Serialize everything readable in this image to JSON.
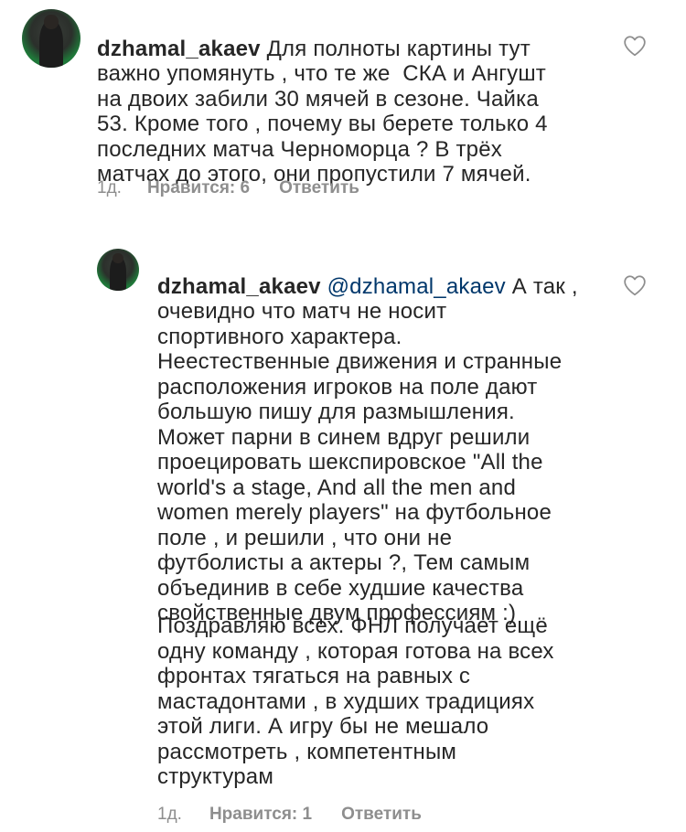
{
  "comments": [
    {
      "username": "dzhamal_akaev",
      "text": "Для полноты картины тут\nважно упомянуть , что те же  СКА и Ангушт\nна двоих забили 30 мячей в сезоне. Чайка\n53. Кроме того , почему вы берете только 4\nпоследних матча Черноморца ? В трёх\nматчах до этого, они пропустили 7 мячей.",
      "time": "1д.",
      "likes": "Нравится: 6",
      "reply": "Ответить",
      "icon": "heart-outline-icon"
    },
    {
      "username": "dzhamal_akaev",
      "mention": "@dzhamal_akaev",
      "text": "А так ,\nочевидно что матч не носит\nспортивного характера.\nНеестественные движения и странные\nрасположения игроков на поле дают\nбольшую пишу для размышления.\nМожет парни в синем вдруг решили\nпроецировать шекспировское \"All the\nworld's a stage, And all the men and\nwomen merely players\" на футбольное\nполе , и решили , что они не\nфутболисты а актеры ?, Тем самым\nобъединив в себе худшие качества\nсвойственные двум профессиям :)",
      "text2": "Поздравляю всех. ФНЛ получает ещё\nодну команду , которая готова на всех\nфронтах тягаться на равных с\nмастадонтами , в худших традициях\nэтой лиги. А игру бы не мешало\nрассмотреть , компетентным\nструктурам",
      "time": "1д.",
      "likes": "Нравится: 1",
      "reply": "Ответить",
      "icon": "heart-outline-icon"
    }
  ],
  "colors": {
    "text": "#262626",
    "meta": "#8e8e8e",
    "mention": "#00376b"
  }
}
